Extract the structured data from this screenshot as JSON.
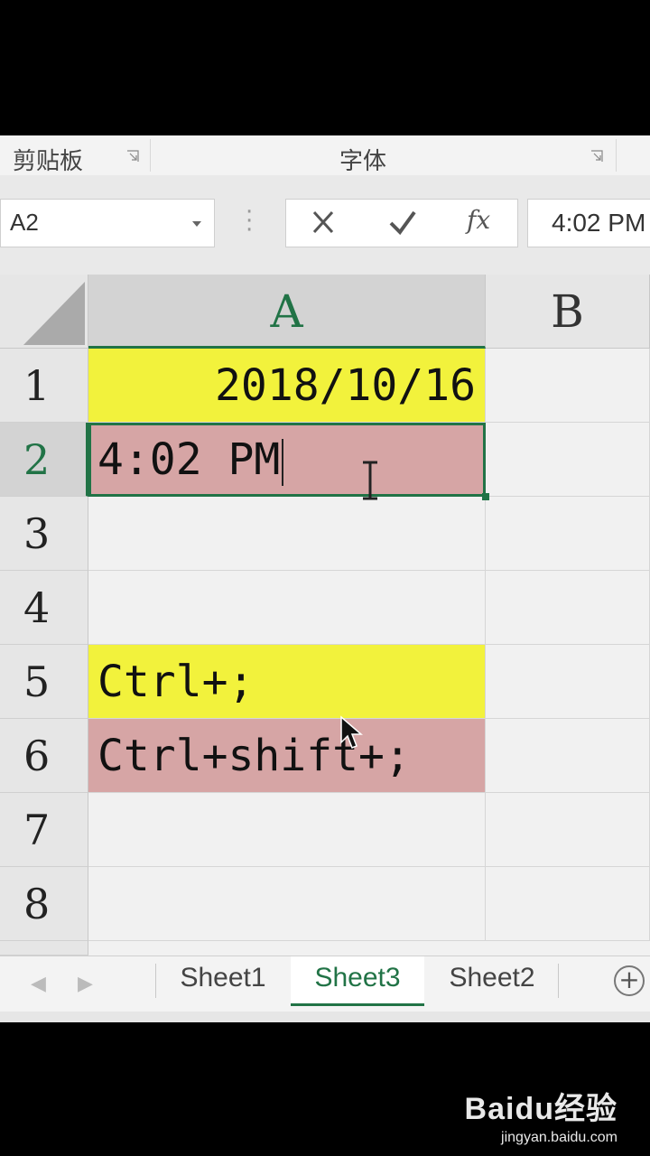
{
  "ribbon": {
    "clipboard_label": "剪贴板",
    "font_label": "字体"
  },
  "formula_bar": {
    "name_box": "A2",
    "cancel_icon": "close-icon",
    "enter_icon": "check-icon",
    "fx_label": "fx",
    "content": "4:02 PM"
  },
  "grid": {
    "columns": [
      "A",
      "B"
    ],
    "active_column": "A",
    "rows": [
      "1",
      "2",
      "3",
      "4",
      "5",
      "6",
      "7",
      "8"
    ],
    "active_row": "2",
    "cells": {
      "A1": {
        "value": "2018/10/16",
        "fill": "#f2f23c"
      },
      "A2": {
        "value": "4:02 PM",
        "fill": "#d6a5a5"
      },
      "A5": {
        "value": "Ctrl+;",
        "fill": "#f2f23c"
      },
      "A6": {
        "value": "Ctrl+shift+;",
        "fill": "#d6a5a5"
      }
    }
  },
  "sheet_tabs": {
    "tabs": [
      "Sheet1",
      "Sheet3",
      "Sheet2"
    ],
    "active": "Sheet3"
  },
  "watermark": {
    "brand": "Baidu经验",
    "url": "jingyan.baidu.com"
  },
  "colors": {
    "accent": "#217346",
    "yellow_fill": "#f2f23c",
    "pink_fill": "#d6a5a5"
  }
}
